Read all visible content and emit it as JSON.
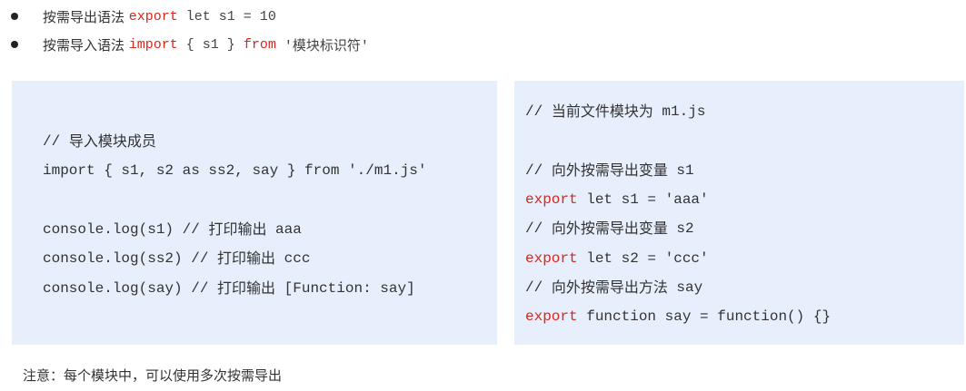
{
  "bullets": [
    {
      "text": "按需导出语法 ",
      "kw": "export",
      "rest": " let s1 = 10"
    },
    {
      "text": "按需导入语法 ",
      "kw1": "import",
      "mid": " { s1 } ",
      "kw2": "from",
      "rest": " '模块标识符'"
    }
  ],
  "left_panel": {
    "lines": [
      {
        "comment": "// ",
        "cn": "导入模块成员"
      },
      {
        "code": "import { s1, s2 as ss2, say } from './m1.js'"
      },
      {
        "code": "console.log(s1) // ",
        "cn": "打印输出",
        "tail": " aaa"
      },
      {
        "code": "console.log(ss2) // ",
        "cn": "打印输出",
        "tail": " ccc"
      },
      {
        "code": "console.log(say) // ",
        "cn": "打印输出",
        "tail": " [Function: say]"
      }
    ]
  },
  "right_panel": {
    "lines": [
      {
        "comment": "// ",
        "cn": "当前文件模块为",
        "tail": " m1.js"
      },
      {
        "comment": "// ",
        "cn": "向外按需导出变量",
        "tail": " s1"
      },
      {
        "kw": "export",
        "rest": " let s1 = 'aaa'"
      },
      {
        "comment": "// ",
        "cn": "向外按需导出变量",
        "tail": " s2"
      },
      {
        "kw": "export",
        "rest": " let s2 = 'ccc'"
      },
      {
        "comment": "// ",
        "cn": "向外按需导出方法",
        "tail": " say"
      },
      {
        "kw": "export",
        "rest": " function say = function() {}"
      }
    ]
  },
  "note": "注意：每个模块中，可以使用多次按需导出",
  "colors": {
    "keyword": "#d9261c",
    "panel_bg": "#e6effb"
  }
}
